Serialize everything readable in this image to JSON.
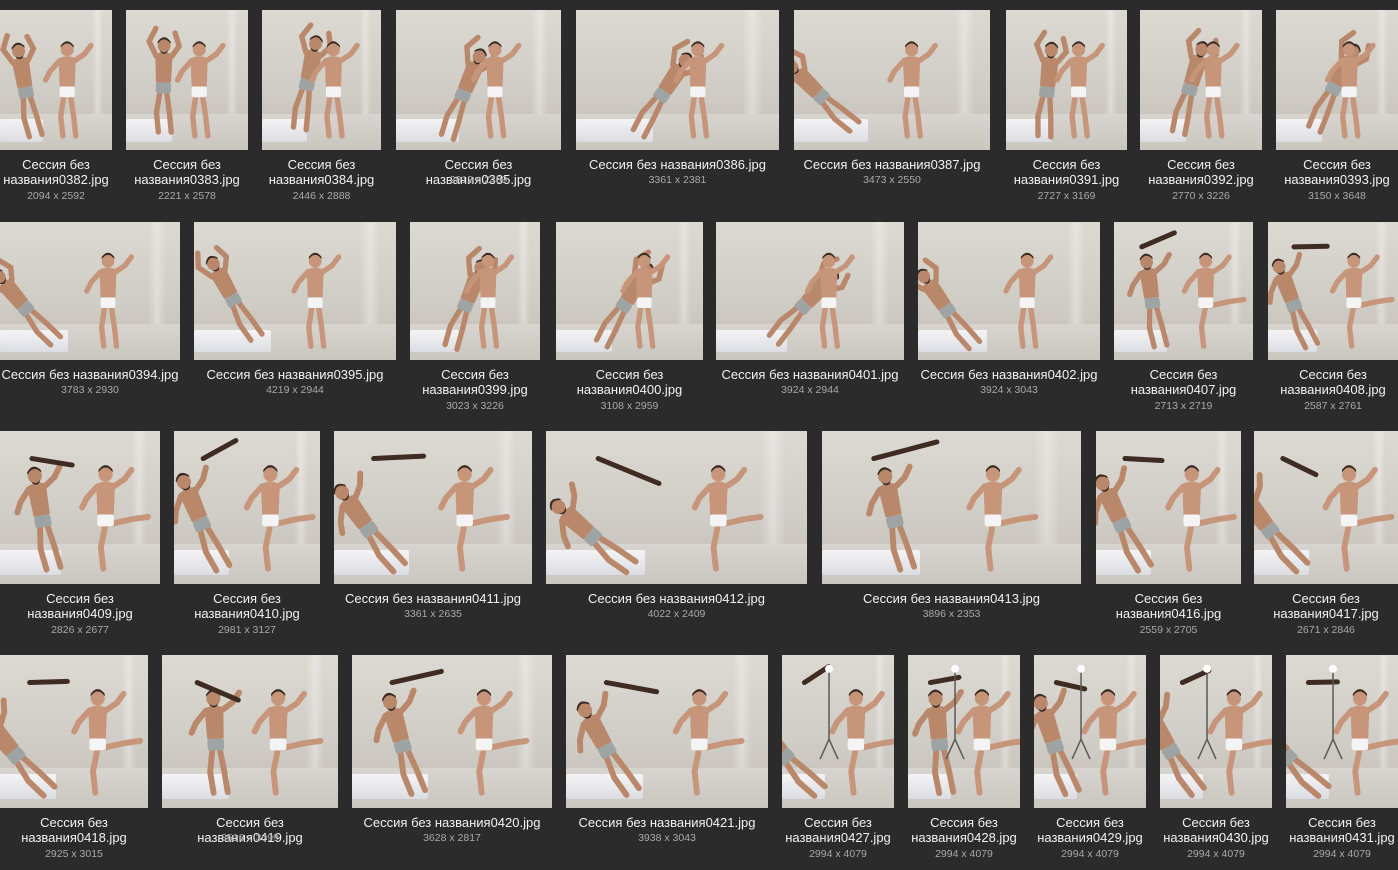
{
  "rows": [
    [
      {
        "name": "Сессия без названия0382.jpg",
        "dims": "2094 x 2592"
      },
      {
        "name": "Сессия без названия0383.jpg",
        "dims": "2221 x 2578"
      },
      {
        "name": "Сессия без названия0384.jpg",
        "dims": "2446 x 2888"
      },
      {
        "name": "Сессия без названия0385.jpg",
        "dims": "2812 x 2409"
      },
      {
        "name": "Сессия без названия0386.jpg",
        "dims": "3361 x 2381"
      },
      {
        "name": "Сессия без названия0387.jpg",
        "dims": "3473 x 2550"
      },
      {
        "name": "Сессия без названия0391.jpg",
        "dims": "2727 x 3169"
      },
      {
        "name": "Сессия без названия0392.jpg",
        "dims": "2770 x 3226"
      },
      {
        "name": "Сессия без названия0393.jpg",
        "dims": "3150 x 3648"
      }
    ],
    [
      {
        "name": "Сессия без названия0394.jpg",
        "dims": "3783 x 2930"
      },
      {
        "name": "Сессия без названия0395.jpg",
        "dims": "4219 x 2944"
      },
      {
        "name": "Сессия без названия0399.jpg",
        "dims": "3023 x 3226"
      },
      {
        "name": "Сессия без названия0400.jpg",
        "dims": "3108 x 2959"
      },
      {
        "name": "Сессия без названия0401.jpg",
        "dims": "3924 x 2944"
      },
      {
        "name": "Сессия без названия0402.jpg",
        "dims": "3924 x 3043"
      },
      {
        "name": "Сессия без названия0407.jpg",
        "dims": "2713 x 2719"
      },
      {
        "name": "Сессия без названия0408.jpg",
        "dims": "2587 x 2761"
      }
    ],
    [
      {
        "name": "Сессия без названия0409.jpg",
        "dims": "2826 x 2677"
      },
      {
        "name": "Сессия без названия0410.jpg",
        "dims": "2981 x 3127"
      },
      {
        "name": "Сессия без названия0411.jpg",
        "dims": "3361 x 2635"
      },
      {
        "name": "Сессия без названия0412.jpg",
        "dims": "4022 x 2409"
      },
      {
        "name": "Сессия без названия0413.jpg",
        "dims": "3896 x 2353"
      },
      {
        "name": "Сессия без названия0416.jpg",
        "dims": "2559 x 2705"
      },
      {
        "name": "Сессия без названия0417.jpg",
        "dims": "2671 x 2846"
      }
    ],
    [
      {
        "name": "Сессия без названия0418.jpg",
        "dims": "2925 x 3015"
      },
      {
        "name": "Сессия без названия0419.jpg",
        "dims": "3516 x 3099"
      },
      {
        "name": "Сессия без названия0420.jpg",
        "dims": "3628 x 2817"
      },
      {
        "name": "Сессия без названия0421.jpg",
        "dims": "3938 x 3043"
      },
      {
        "name": "Сессия без названия0427.jpg",
        "dims": "2994 x 4079"
      },
      {
        "name": "Сессия без названия0428.jpg",
        "dims": "2994 x 4079"
      },
      {
        "name": "Сессия без названия0429.jpg",
        "dims": "2994 x 4079"
      },
      {
        "name": "Сессия без названия0430.jpg",
        "dims": "2994 x 4079"
      },
      {
        "name": "Сессия без названия0431.jpg",
        "dims": "2994 x 4079"
      }
    ]
  ]
}
